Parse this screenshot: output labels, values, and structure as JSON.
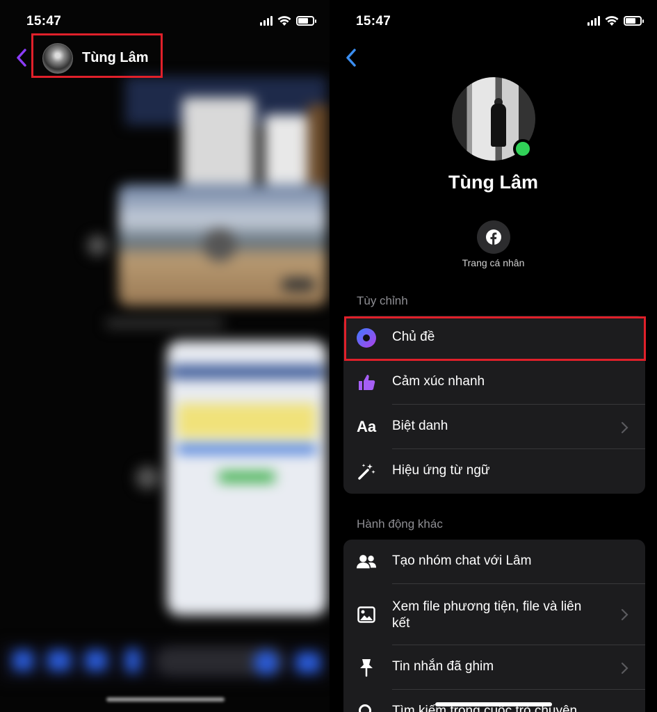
{
  "status_bar": {
    "time": "15:47"
  },
  "left": {
    "contact_name": "Tùng Lâm"
  },
  "right": {
    "profile_name": "Tùng Lâm",
    "profile_button_label": "Trang cá nhân",
    "sections": [
      {
        "title": "Tùy chỉnh",
        "items": [
          {
            "label": "Chủ đề",
            "icon": "theme-icon",
            "chevron": false
          },
          {
            "label": "Cảm xúc nhanh",
            "icon": "thumbs-up-icon",
            "chevron": false
          },
          {
            "label": "Biệt danh",
            "icon": "nickname-icon",
            "chevron": true
          },
          {
            "label": "Hiệu ứng từ ngữ",
            "icon": "magic-wand-icon",
            "chevron": false
          }
        ]
      },
      {
        "title": "Hành động khác",
        "items": [
          {
            "label": "Tạo nhóm chat với Lâm",
            "icon": "group-icon",
            "chevron": false
          },
          {
            "label": "Xem file phương tiện, file và liên kết",
            "icon": "image-icon",
            "chevron": true
          },
          {
            "label": "Tin nhắn đã ghim",
            "icon": "pin-icon",
            "chevron": true
          },
          {
            "label": "Tìm kiếm trong cuộc trò chuyện",
            "icon": "search-icon",
            "chevron": false
          }
        ]
      }
    ]
  },
  "colors": {
    "accent_purple": "#8b3cf7",
    "online_green": "#31d158",
    "highlight_red": "#e0202a",
    "back_arrow_blue": "#3b8ef0"
  }
}
